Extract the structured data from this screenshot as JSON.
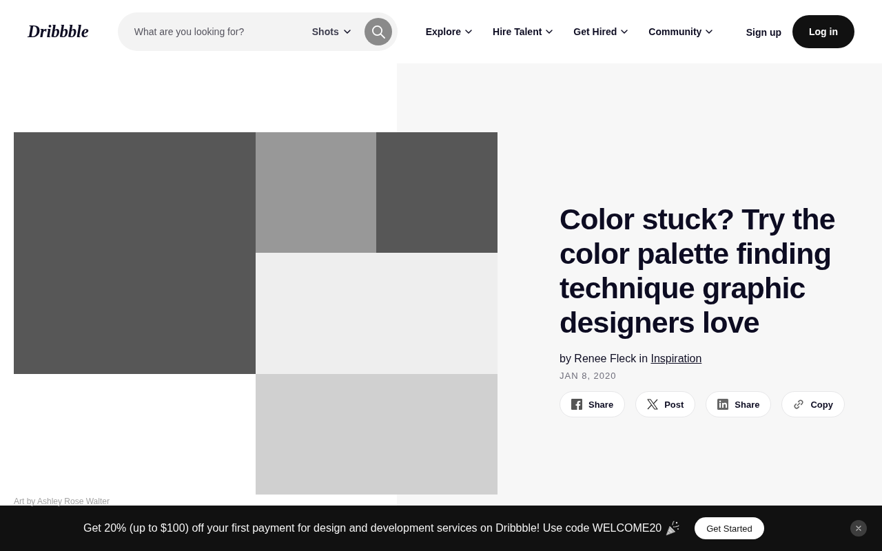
{
  "header": {
    "logo": "Dribbble",
    "search": {
      "placeholder": "What are you looking for?",
      "scope": "Shots"
    },
    "nav": [
      "Explore",
      "Hire Talent",
      "Get Hired",
      "Community"
    ],
    "sign_up": "Sign up",
    "log_in": "Log in"
  },
  "article": {
    "image_caption": "Art by Ashley Rose Walter",
    "title": "Color stuck? Try the color palette finding technique graphic designers love",
    "byline": {
      "text": "by Renee Fleck in",
      "category": "Inspiration"
    },
    "date": "JAN 8, 2020",
    "share_buttons": [
      {
        "kind": "facebook",
        "label": "Share"
      },
      {
        "kind": "x",
        "label": "Post"
      },
      {
        "kind": "linkedin",
        "label": "Share"
      },
      {
        "kind": "copy",
        "label": "Copy"
      }
    ]
  },
  "promo_banner": {
    "text": "Get 20% (up to $100) off your first payment for design and development services on Dribbble! Use code WELCOME20",
    "button": "Get Started"
  }
}
